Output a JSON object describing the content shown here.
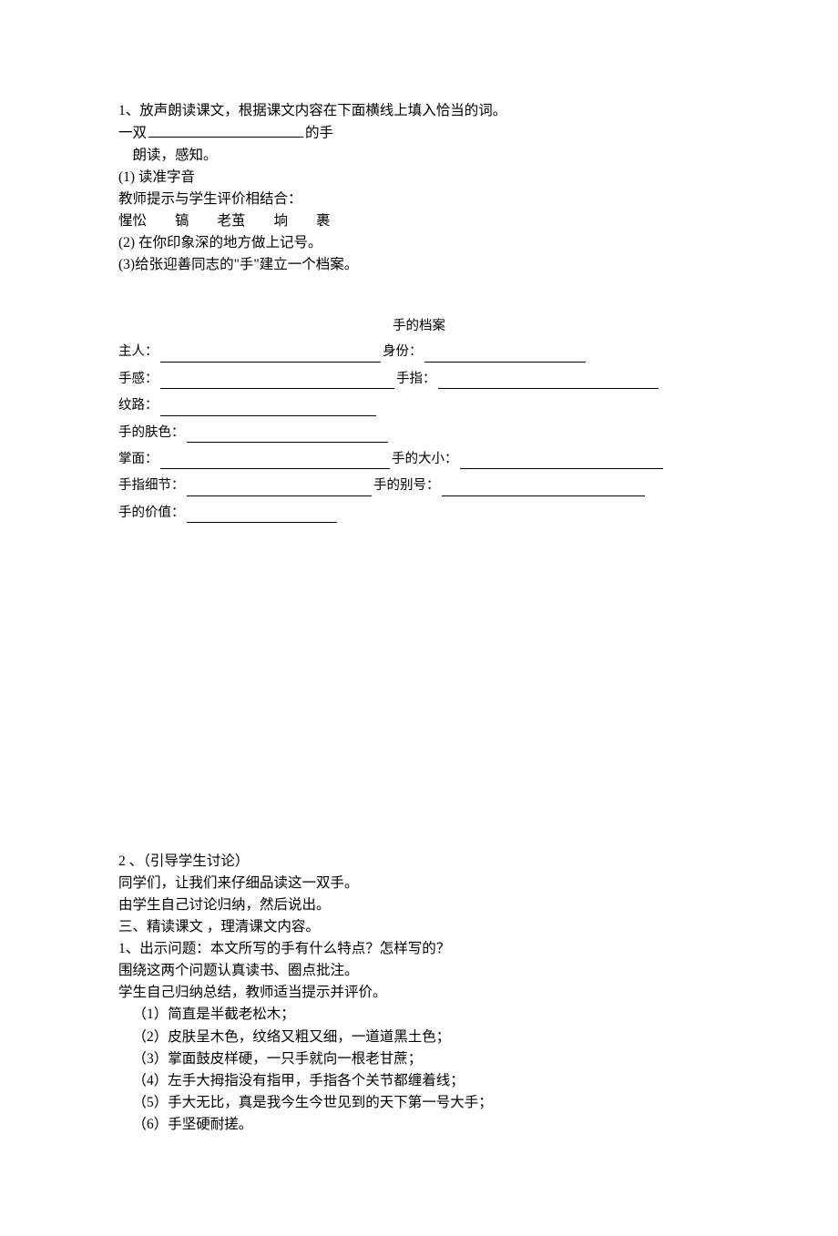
{
  "section1": {
    "line1": "1、放声朗读课文，根据课文内容在下面横线上填入恰当的词。",
    "line2_prefix": "一双",
    "line2_suffix": "的手",
    "line3": "　朗读，感知。",
    "line4": "(1) 读准字音",
    "line5": "教师提示与学生评价相结合：",
    "line6": "惺忪　　镐　　老茧　　垧　　裹",
    "line7": "(2) 在你印象深的地方做上记号。",
    "line8": "(3)给张迎善同志的\"手\"建立一个档案。"
  },
  "archive": {
    "title": "手的档案",
    "owner_label": "主人：",
    "identity_label": "身份：",
    "feel_label": "手感：",
    "finger_label": "手指：",
    "texture_label": "纹路：",
    "skin_label": "手的肤色：",
    "palm_label": "掌面：",
    "size_label": "手的大小：",
    "detail_label": "手指细节：",
    "nickname_label": "手的别号：",
    "value_label": "手的价值："
  },
  "section2": {
    "line1": "2 、（引导学生讨论）",
    "line2": "同学们，让我们来仔细品读这一双手。",
    "line3": "由学生自己讨论归纳，然后说出。",
    "line4": "三、精读课文 ，理清课文内容。",
    "line5": "1、出示问题：本文所写的手有什么特点？怎样写的？",
    "line6": "围绕这两个问题认真读书、圈点批注。",
    "line7": "学生自己归纳总结，教师适当提示并评价。",
    "item1": "（1）简直是半截老松木；",
    "item2": "（2）皮肤呈木色，纹络又粗又细，一道道黑土色；",
    "item3": "（3）掌面鼓皮样硬，一只手就向一根老甘蔗；",
    "item4": "（4）左手大拇指没有指甲，手指各个关节都缠着线；",
    "item5": "（5）手大无比，真是我今生今世见到的天下第一号大手；",
    "item6": "（6）手坚硬耐搓。"
  }
}
